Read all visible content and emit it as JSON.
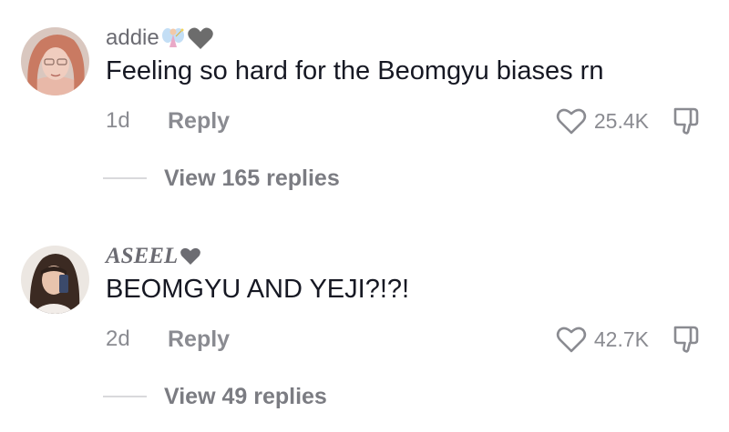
{
  "comments": [
    {
      "username": "addie",
      "username_emojis": [
        "fairy-icon",
        "grey-heart-icon"
      ],
      "text": "Feeling so hard for the Beomgyu biases rn",
      "age": "1d",
      "reply_label": "Reply",
      "likes": "25.4K",
      "view_replies": "View 165 replies"
    },
    {
      "username": "ASEEL",
      "username_emojis": [
        "black-heart-icon"
      ],
      "text": "BEOMGYU AND YEJI?!?!",
      "age": "2d",
      "reply_label": "Reply",
      "likes": "42.7K",
      "view_replies": "View 49 replies"
    }
  ],
  "colors": {
    "text_primary": "#161823",
    "text_secondary": "#8a8b91",
    "divider": "#d9d9dc"
  }
}
